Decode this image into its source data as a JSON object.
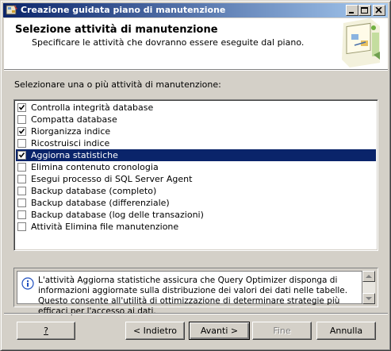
{
  "window": {
    "title": "Creazione guidata piano di manutenzione"
  },
  "header": {
    "title": "Selezione attività di manutenzione",
    "subtitle": "Specificare le attività che dovranno essere eseguite dal piano."
  },
  "list": {
    "label": "Selezionare una o più attività di manutenzione:",
    "items": [
      {
        "label": "Controlla integrità database",
        "checked": true,
        "selected": false
      },
      {
        "label": "Compatta database",
        "checked": false,
        "selected": false
      },
      {
        "label": "Riorganizza indice",
        "checked": true,
        "selected": false
      },
      {
        "label": "Ricostruisci indice",
        "checked": false,
        "selected": false
      },
      {
        "label": "Aggiorna statistiche",
        "checked": true,
        "selected": true
      },
      {
        "label": "Elimina contenuto cronologia",
        "checked": false,
        "selected": false
      },
      {
        "label": "Esegui processo di SQL Server Agent",
        "checked": false,
        "selected": false
      },
      {
        "label": "Backup database (completo)",
        "checked": false,
        "selected": false
      },
      {
        "label": "Backup database (differenziale)",
        "checked": false,
        "selected": false
      },
      {
        "label": "Backup database (log delle transazioni)",
        "checked": false,
        "selected": false
      },
      {
        "label": "Attività Elimina file manutenzione",
        "checked": false,
        "selected": false
      }
    ]
  },
  "description": {
    "text": "L'attività Aggiorna statistiche assicura che Query Optimizer disponga di informazioni aggiornate sulla distribuzione dei valori dei dati nelle tabelle. Questo consente all'utilità di ottimizzazione di determinare strategie più efficaci per l'accesso ai dati."
  },
  "buttons": {
    "help": "?",
    "back": "< Indietro",
    "next": "Avanti >",
    "finish": "Fine",
    "cancel": "Annulla"
  },
  "icons": {
    "app": "wizard-app-icon",
    "minimize": "minimize-icon",
    "maximize": "maximize-icon",
    "close": "close-icon",
    "info": "info-icon",
    "header_art": "maintenance-plan-illustration"
  },
  "colors": {
    "title_bar_start": "#0a246a",
    "title_bar_end": "#a6caf0",
    "selection": "#0a246a",
    "face": "#d4d0c8"
  }
}
